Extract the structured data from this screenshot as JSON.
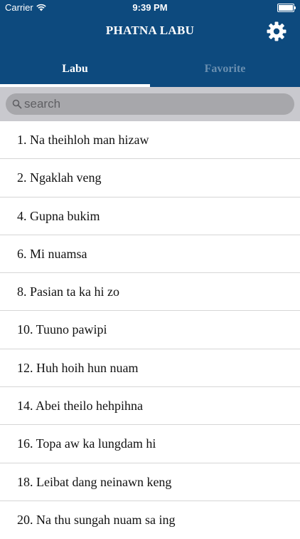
{
  "status_bar": {
    "carrier": "Carrier",
    "time": "9:39 PM",
    "battery_level": 1.0
  },
  "header": {
    "title": "PHATNA LABU",
    "settings_icon": "gear-icon"
  },
  "tabs": [
    {
      "label": "Labu",
      "active": true
    },
    {
      "label": "Favorite",
      "active": false
    }
  ],
  "search": {
    "placeholder": "search",
    "value": ""
  },
  "songs": [
    "1. Na theihloh man hizaw",
    "2. Ngaklah veng",
    "4. Gupna bukim",
    "6. Mi nuamsa",
    "8. Pasian ta ka hi zo",
    "10. Tuuno pawipi",
    "12. Huh hoih hun nuam",
    "14. Abei theilo hehpihna",
    "16. Topa aw ka lungdam hi",
    "18. Leibat dang neinawn keng",
    "20. Na thu sungah nuam sa ing"
  ],
  "colors": {
    "nav_background": "#0d4a7e",
    "search_background": "#c9c9ce",
    "tab_inactive": "#6a8fb0"
  }
}
